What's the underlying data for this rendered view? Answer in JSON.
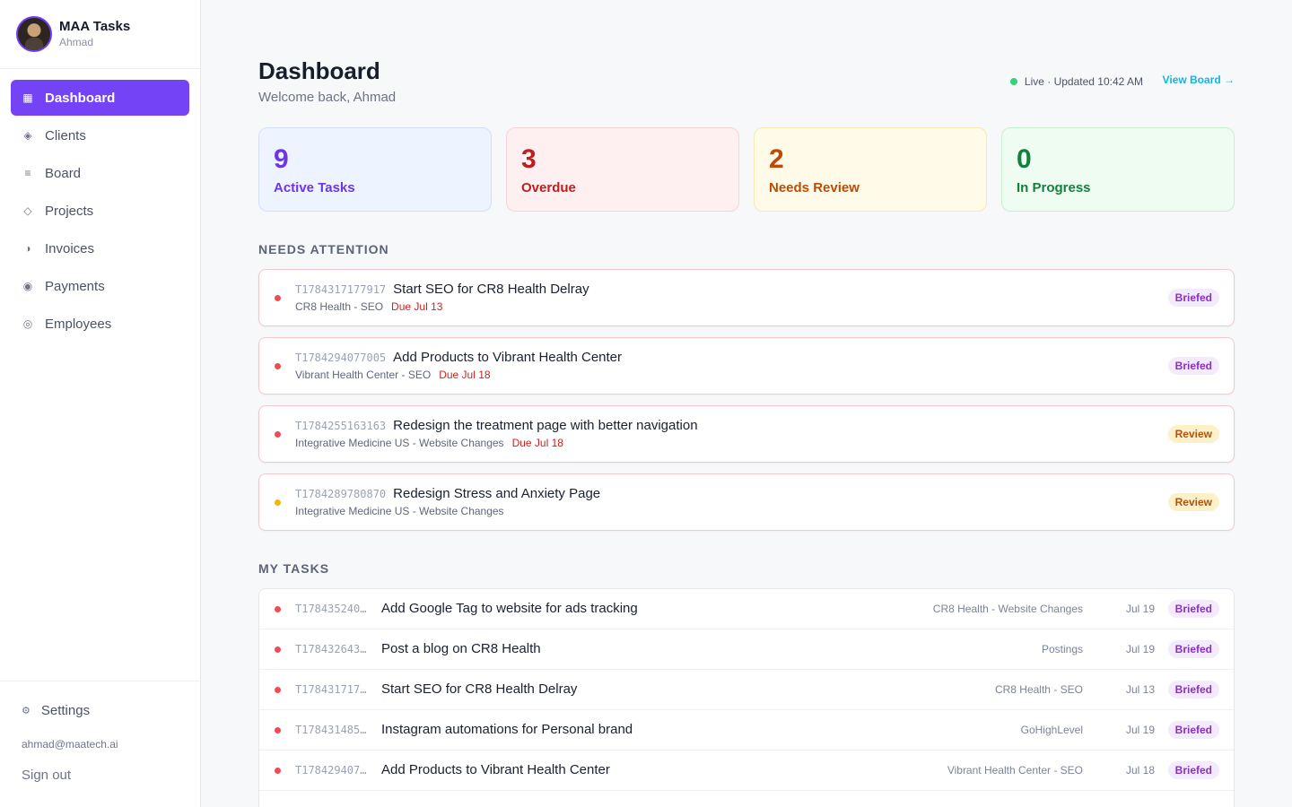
{
  "app": {
    "title": "MAA Tasks",
    "user": "Ahmad"
  },
  "sidebar": {
    "items": [
      {
        "label": "Dashboard",
        "icon": "grid-icon"
      },
      {
        "label": "Clients",
        "icon": "diamond-icon"
      },
      {
        "label": "Board",
        "icon": "list-icon"
      },
      {
        "label": "Projects",
        "icon": "diamond-outline-icon"
      },
      {
        "label": "Invoices",
        "icon": "half-circle-icon"
      },
      {
        "label": "Payments",
        "icon": "target-icon"
      },
      {
        "label": "Employees",
        "icon": "ring-icon"
      }
    ],
    "settings_label": "Settings",
    "email": "ahmad@maatech.ai",
    "signout_label": "Sign out"
  },
  "header": {
    "title": "Dashboard",
    "welcome": "Welcome back, Ahmad",
    "live_status": "Live · Updated 10:42 AM",
    "view_board": "View Board →"
  },
  "stats": [
    {
      "value": "9",
      "label": "Active Tasks",
      "color": "#6d35e8"
    },
    {
      "value": "3",
      "label": "Overdue",
      "color": "#c21d1d"
    },
    {
      "value": "2",
      "label": "Needs Review",
      "color": "#bd4b06"
    },
    {
      "value": "0",
      "label": "In Progress",
      "color": "#15803d"
    }
  ],
  "attention": {
    "heading": "NEEDS ATTENTION",
    "items": [
      {
        "id": "T1784317177917",
        "title": "Start SEO for CR8 Health Delray",
        "project": "CR8 Health - SEO",
        "due": "Due Jul 13",
        "status": "Briefed",
        "dot": "#ee4b55"
      },
      {
        "id": "T1784294077005",
        "title": "Add Products to Vibrant Health Center",
        "project": "Vibrant Health Center - SEO",
        "due": "Due Jul 18",
        "status": "Briefed",
        "dot": "#ee4b55"
      },
      {
        "id": "T1784255163163",
        "title": "Redesign the treatment page with better navigation",
        "project": "Integrative Medicine US - Website Changes",
        "due": "Due Jul 18",
        "status": "Review",
        "dot": "#ee4b55"
      },
      {
        "id": "T1784289780870",
        "title": "Redesign Stress and Anxiety Page",
        "project": "Integrative Medicine US - Website Changes",
        "due": "",
        "status": "Review",
        "dot": "#f5b40c"
      }
    ]
  },
  "my_tasks": {
    "heading": "MY TASKS",
    "rows": [
      {
        "id": "T178435240…",
        "title": "Add Google Tag to website for ads tracking",
        "project": "CR8 Health - Website Changes",
        "date": "Jul 19",
        "status": "Briefed"
      },
      {
        "id": "T178432643…",
        "title": "Post a blog on CR8 Health",
        "project": "Postings",
        "date": "Jul 19",
        "status": "Briefed"
      },
      {
        "id": "T178431717…",
        "title": "Start SEO for CR8 Health Delray",
        "project": "CR8 Health - SEO",
        "date": "Jul 13",
        "status": "Briefed"
      },
      {
        "id": "T178431485…",
        "title": "Instagram automations for Personal brand",
        "project": "GoHighLevel",
        "date": "Jul 19",
        "status": "Briefed"
      },
      {
        "id": "T178429407…",
        "title": "Add Products to Vibrant Health Center",
        "project": "Vibrant Health Center - SEO",
        "date": "Jul 18",
        "status": "Briefed"
      }
    ]
  },
  "colors": {
    "accent": "#7443f6",
    "link": "#12b7e0",
    "live": "#34d27a"
  }
}
